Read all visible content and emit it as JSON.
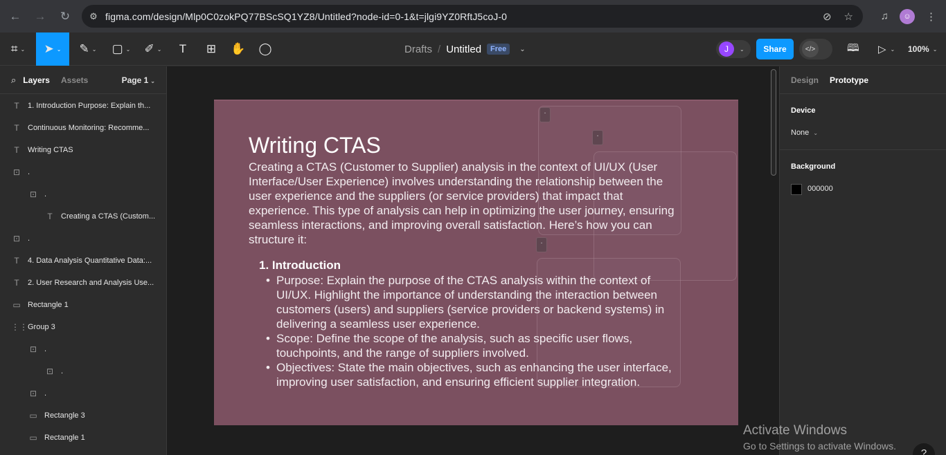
{
  "browser": {
    "url": "figma.com/design/Mlp0C0zokPQ77BScSQ1YZ8/Untitled?node-id=0-1&t=jlgi9YZ0RftJ5coJ-0",
    "back_icon": "←",
    "forward_icon": "→",
    "reload_icon": "↻",
    "site_info_icon": "⚙",
    "no_tracking_icon": "⊘",
    "bookmark_icon": "☆",
    "media_icon": "♫",
    "profile_icon": "☺",
    "menu_icon": "⋮"
  },
  "toolbar": {
    "main_menu_icon": "⌗",
    "move_icon": "➤",
    "pen_icon": "✎",
    "frame_icon": "▢",
    "pencil_icon": "✐",
    "text_icon": "T",
    "resources_icon": "⊞",
    "hand_icon": "✋",
    "comment_icon": "◯",
    "chevron": "⌄",
    "breadcrumb_drafts": "Drafts",
    "breadcrumb_sep": "/",
    "file_name": "Untitled",
    "plan_badge": "Free",
    "avatar_initial": "J",
    "share_label": "Share",
    "dev_mode_icon": "</>",
    "library_icon": "🕮",
    "present_icon": "▷",
    "zoom": "100%"
  },
  "left_panel": {
    "search_icon": "⌕",
    "tab_layers": "Layers",
    "tab_assets": "Assets",
    "page": "Page 1",
    "layers": [
      {
        "icon": "T",
        "label": "1. Introduction Purpose: Explain th..."
      },
      {
        "icon": "T",
        "label": "Continuous Monitoring: Recomme..."
      },
      {
        "icon": "T",
        "label": "Writing CTAS"
      },
      {
        "icon": "⊡",
        "label": "."
      },
      {
        "icon": "⊡",
        "label": "."
      },
      {
        "icon": "T",
        "label": "Creating a CTAS (Custom..."
      },
      {
        "icon": "⊡",
        "label": "."
      },
      {
        "icon": "T",
        "label": "4. Data Analysis Quantitative Data:..."
      },
      {
        "icon": "T",
        "label": "2. User Research and Analysis Use..."
      },
      {
        "icon": "▭",
        "label": "Rectangle 1"
      },
      {
        "icon": "⋮⋮",
        "label": "Group 3"
      },
      {
        "icon": "⊡",
        "label": "."
      },
      {
        "icon": "⊡",
        "label": "."
      },
      {
        "icon": "⊡",
        "label": "."
      },
      {
        "icon": "▭",
        "label": "Rectangle 3"
      },
      {
        "icon": "▭",
        "label": "Rectangle 1"
      }
    ]
  },
  "canvas": {
    "title": "Writing  CTAS",
    "paragraph": "Creating a CTAS (Customer to Supplier) analysis in the context of UI/UX (User Interface/User Experience) involves understanding the relationship between the user experience and the suppliers (or service providers) that impact that experience. This type of analysis can help in optimizing the user journey, ensuring seamless interactions, and improving overall satisfaction. Here’s how you can structure it:",
    "section_heading": "1. Introduction",
    "bullets": [
      "Purpose: Explain the purpose of the CTAS analysis within the context of UI/UX. Highlight the importance of understanding the interaction between customers (users) and suppliers (service providers or backend systems) in delivering a seamless user experience.",
      "Scope: Define the scope of the analysis, such as specific user flows, touchpoints, and the range of suppliers involved.",
      "Objectives: State the main objectives, such as enhancing the user interface, improving user satisfaction, and ensuring efficient supplier integration."
    ],
    "dot_tag": "."
  },
  "right_panel": {
    "tab_design": "Design",
    "tab_prototype": "Prototype",
    "device_label": "Device",
    "device_value": "None",
    "device_chevron": "⌄",
    "background_label": "Background",
    "background_hex": "000000",
    "background_color": "#000000"
  },
  "watermark": {
    "line1": "Activate Windows",
    "line2": "Go to Settings to activate Windows.",
    "help_label": "?"
  }
}
